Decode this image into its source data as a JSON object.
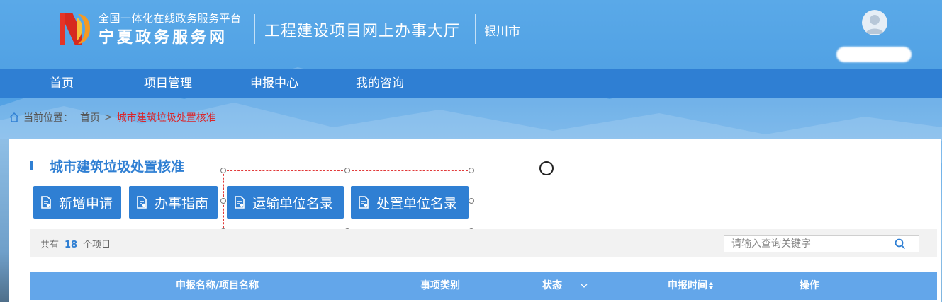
{
  "header": {
    "platform_top": "全国一体化在线政务服务平台",
    "platform_name": "宁夏政务服务网",
    "hall_title": "工程建设项目网上办事大厅",
    "city": "银川市"
  },
  "nav": {
    "items": [
      {
        "label": "首页"
      },
      {
        "label": "项目管理"
      },
      {
        "label": "申报中心"
      },
      {
        "label": "我的咨询"
      }
    ]
  },
  "breadcrumb": {
    "prefix": "当前位置：",
    "home": "首页",
    "separator": ">",
    "current": "城市建筑垃圾处置核准"
  },
  "panel": {
    "title": "城市建筑垃圾处置核准",
    "buttons": [
      {
        "label": "新增申请",
        "icon": "document-icon"
      },
      {
        "label": "办事指南",
        "icon": "document-icon"
      },
      {
        "label": "运输单位名录",
        "icon": "document-icon"
      },
      {
        "label": "处置单位名录",
        "icon": "document-icon"
      }
    ],
    "count_prefix": "共有",
    "count": "18",
    "count_suffix": "个项目",
    "search_placeholder": "请输入查询关键字"
  },
  "table": {
    "headers": {
      "name": "申报名称/项目名称",
      "category": "事项类别",
      "status": "状态",
      "time": "申报时间",
      "action": "操作"
    }
  },
  "colors": {
    "accent": "#2f7fd3",
    "header_row": "#63a6ea",
    "breadcrumb_current": "#d9262b",
    "selection_outline": "#e23a3a"
  }
}
